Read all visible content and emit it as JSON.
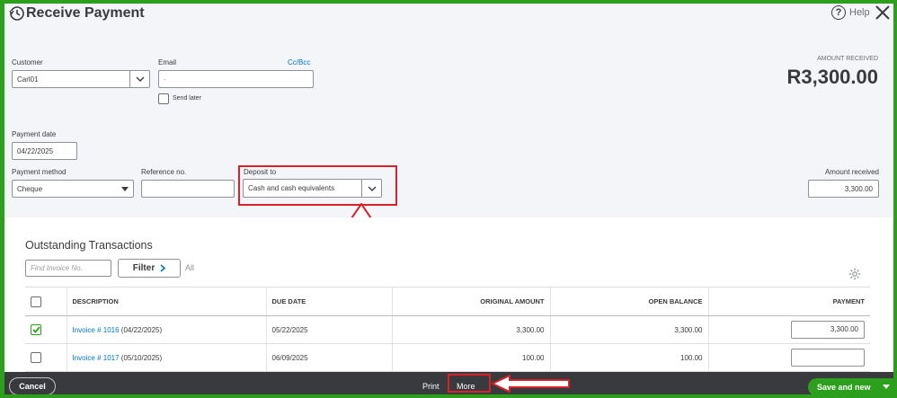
{
  "header": {
    "title": "Receive Payment",
    "help_label": "Help"
  },
  "customer": {
    "label": "Customer",
    "value": "Carl01"
  },
  "email": {
    "label": "Email",
    "value": "-",
    "cc_bcc": "Cc/Bcc",
    "send_later_label": "Send later",
    "send_later_checked": false
  },
  "amount_received_summary": {
    "caption": "AMOUNT RECEIVED",
    "value": "R3,300.00"
  },
  "payment_date": {
    "label": "Payment date",
    "value": "04/22/2025"
  },
  "payment_method": {
    "label": "Payment method",
    "value": "Cheque"
  },
  "reference_no": {
    "label": "Reference no.",
    "value": ""
  },
  "deposit_to": {
    "label": "Deposit to",
    "value": "Cash and cash equivalents"
  },
  "amount_received_field": {
    "label": "Amount received",
    "value": "3,300.00"
  },
  "outstanding": {
    "title": "Outstanding Transactions",
    "find_placeholder": "Find Invoice No.",
    "filter_label": "Filter",
    "all_label": "All",
    "columns": [
      "DESCRIPTION",
      "DUE DATE",
      "ORIGINAL AMOUNT",
      "OPEN BALANCE",
      "PAYMENT"
    ],
    "rows": [
      {
        "checked": true,
        "invoice": "Invoice # 1016",
        "date": "(04/22/2025)",
        "due_date": "05/22/2025",
        "original_amount": "3,300.00",
        "open_balance": "3,300.00",
        "payment": "3,300.00"
      },
      {
        "checked": false,
        "invoice": "Invoice # 1017",
        "date": "(05/10/2025)",
        "due_date": "06/09/2025",
        "original_amount": "100.00",
        "open_balance": "100.00",
        "payment": ""
      }
    ]
  },
  "footer": {
    "cancel_label": "Cancel",
    "print_label": "Print",
    "more_label": "More",
    "save_label": "Save and new"
  },
  "colors": {
    "brand_green": "#2ca01c",
    "annotation_red": "#d82128",
    "link_blue": "#0077c5",
    "footer_dark": "#393a3d"
  }
}
